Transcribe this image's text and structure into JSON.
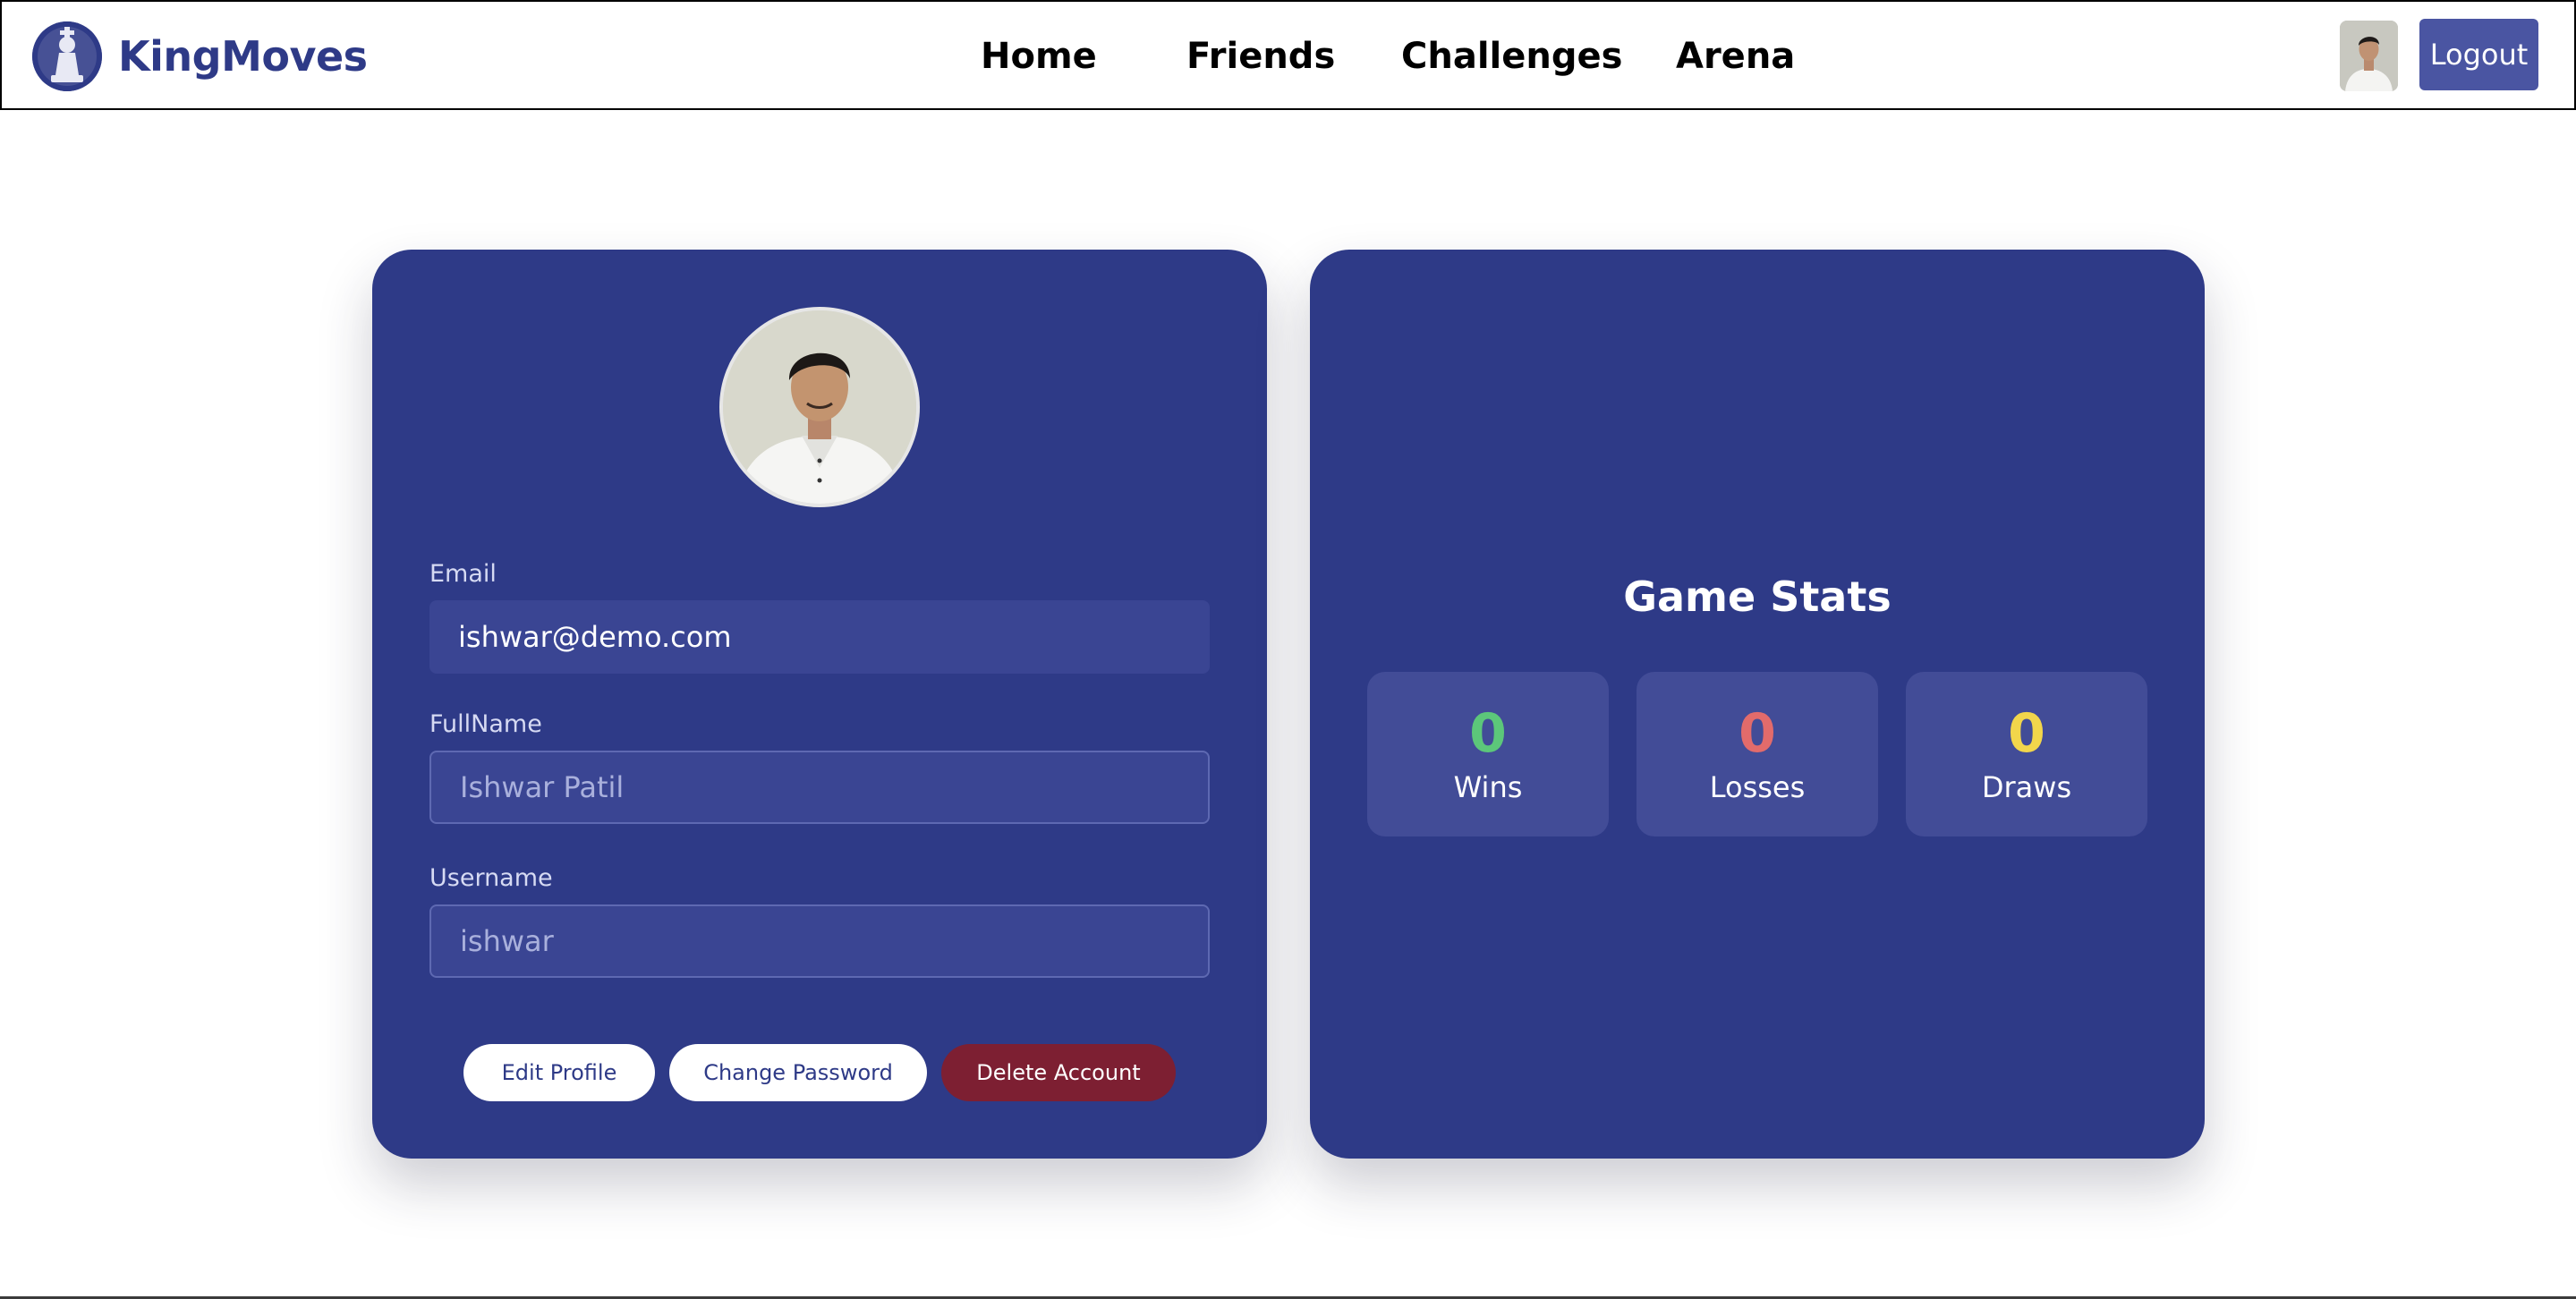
{
  "navbar": {
    "brand": "KingMoves",
    "links": [
      "Home",
      "Friends",
      "Challenges",
      "Arena"
    ],
    "logout_label": "Logout"
  },
  "profile": {
    "email_label": "Email",
    "email_value": "ishwar@demo.com",
    "fullname_label": "FullName",
    "fullname_placeholder": "Ishwar Patil",
    "username_label": "Username",
    "username_placeholder": "ishwar",
    "buttons": {
      "edit": "Edit Profile",
      "change_password": "Change Password",
      "delete": "Delete Account"
    }
  },
  "stats": {
    "title": "Game Stats",
    "items": [
      {
        "value": "0",
        "label": "Wins",
        "color": "#5cc77a"
      },
      {
        "value": "0",
        "label": "Losses",
        "color": "#e26b6b"
      },
      {
        "value": "0",
        "label": "Draws",
        "color": "#f2d64b"
      }
    ]
  },
  "colors": {
    "brand": "#2e3a87",
    "card": "#2e3a87",
    "logout": "#4a55a2",
    "danger": "#7d1f32"
  }
}
